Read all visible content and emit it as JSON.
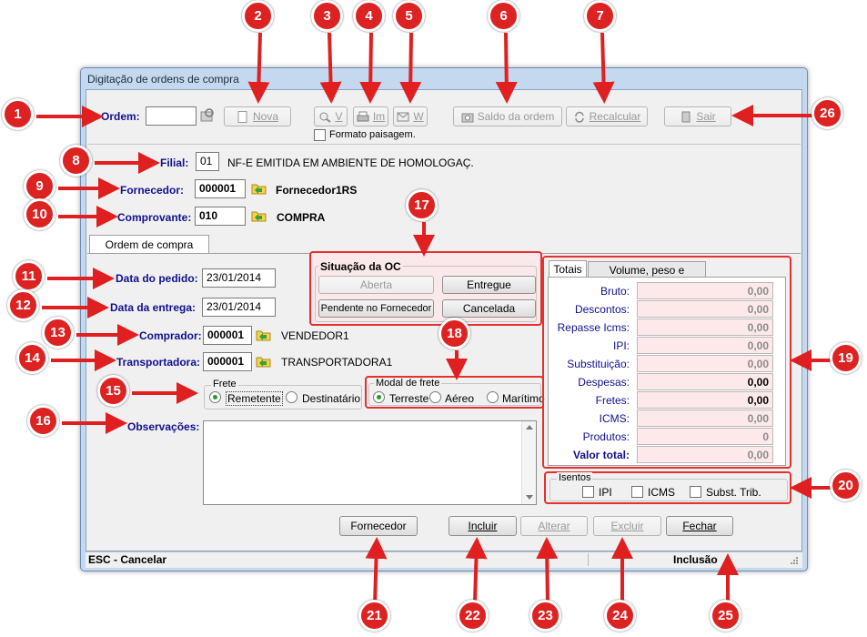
{
  "window": {
    "title": "Digitação de ordens de compra"
  },
  "toolbar": {
    "ordem_label": "Ordem:",
    "nova_label": "Nova",
    "visualizar_label": "V",
    "imprimir_label": "Im",
    "email_label": "W",
    "saldo_label": "Saldo da ordem",
    "recalcular_label": "Recalcular",
    "sair_label": "Sair",
    "formato_label": "Formato paisagem."
  },
  "header": {
    "filial_label": "Filial:",
    "filial_code": "01",
    "filial_name": "NF-E EMITIDA EM AMBIENTE DE HOMOLOGAÇ.",
    "fornecedor_label": "Fornecedor:",
    "fornecedor_code": "000001",
    "fornecedor_name": "Fornecedor1RS",
    "comprovante_label": "Comprovante:",
    "comprovante_code": "010",
    "comprovante_name": "COMPRA"
  },
  "tabs": {
    "main_tab": "Ordem de compra"
  },
  "form": {
    "data_pedido_label": "Data do pedido:",
    "data_pedido": "23/01/2014",
    "data_entrega_label": "Data da entrega:",
    "data_entrega": "23/01/2014",
    "comprador_label": "Comprador:",
    "comprador_code": "000001",
    "comprador_name": "VENDEDOR1",
    "transportadora_label": "Transportadora:",
    "transportadora_code": "000001",
    "transportadora_name": "TRANSPORTADORA1",
    "observacoes_label": "Observações:"
  },
  "situacao": {
    "title": "Situação da OC",
    "aberta": "Aberta",
    "entregue": "Entregue",
    "pendente": "Pendente no Fornecedor",
    "cancelada": "Cancelada"
  },
  "frete": {
    "title": "Frete",
    "remetente": "Remetente",
    "destinatario": "Destinatário",
    "selected": "Remetente"
  },
  "modal": {
    "title": "Modal de frete",
    "terreste": "Terreste",
    "aereo": "Aéreo",
    "maritimo": "Marítimo",
    "selected": "Terreste"
  },
  "totais": {
    "tab_totais": "Totais",
    "tab_volume": "Volume, peso e cubagem",
    "rows": [
      {
        "label": "Bruto:",
        "value": "0,00"
      },
      {
        "label": "Descontos:",
        "value": "0,00"
      },
      {
        "label": "Repasse Icms:",
        "value": "0,00"
      },
      {
        "label": "IPI:",
        "value": "0,00"
      },
      {
        "label": "Substituição:",
        "value": "0,00"
      },
      {
        "label": "Despesas:",
        "value": "0,00"
      },
      {
        "label": "Fretes:",
        "value": "0,00"
      },
      {
        "label": "ICMS:",
        "value": "0,00"
      },
      {
        "label": "Produtos:",
        "value": "0"
      },
      {
        "label": "Valor total:",
        "value": "0,00"
      }
    ]
  },
  "isentos": {
    "title": "Isentos",
    "ipi": "IPI",
    "icms": "ICMS",
    "subst": "Subst. Trib."
  },
  "actions": {
    "fornecedor": "Fornecedor",
    "incluir": "Incluir",
    "alterar": "Alterar",
    "excluir": "Excluir",
    "fechar": "Fechar"
  },
  "status": {
    "left": "ESC - Cancelar",
    "right": "Inclusão"
  },
  "callouts": [
    "1",
    "2",
    "3",
    "4",
    "5",
    "6",
    "7",
    "8",
    "9",
    "10",
    "11",
    "12",
    "13",
    "14",
    "15",
    "16",
    "17",
    "18",
    "19",
    "20",
    "21",
    "22",
    "23",
    "24",
    "25",
    "26"
  ],
  "colors": {
    "callout_red": "#dd2222",
    "window_frame": "#c4d9ef",
    "totals_fill": "#fde9ea"
  }
}
